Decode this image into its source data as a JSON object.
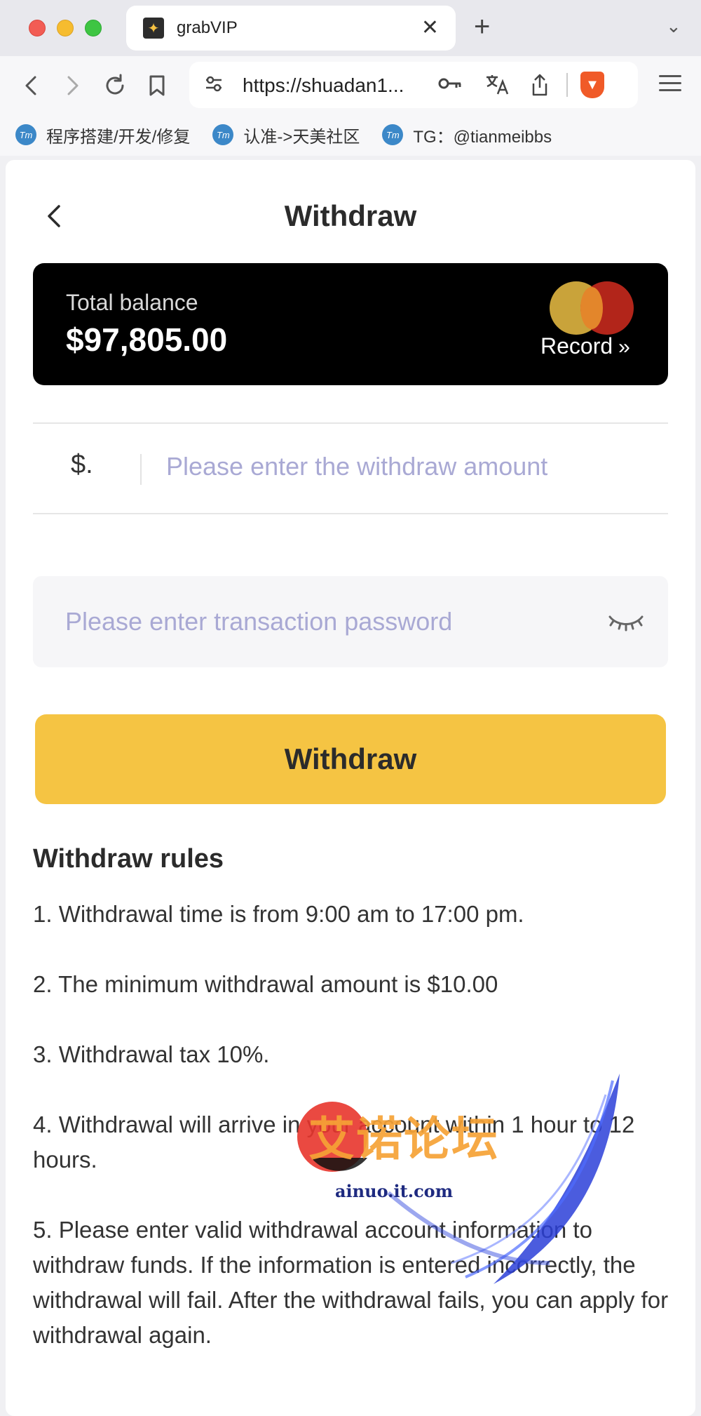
{
  "browser": {
    "tab_title": "grabVIP",
    "tab_close": "✕",
    "new_tab": "+",
    "tab_menu": "⌄",
    "url": "https://shuadan1...",
    "bookmarks": [
      {
        "icon": "Tm",
        "label": "程序搭建/开发/修复"
      },
      {
        "icon": "Tm",
        "label": "认准->天美社区"
      },
      {
        "icon": "Tm",
        "label": "TG：@tianmeibbs"
      }
    ]
  },
  "header": {
    "title": "Withdraw"
  },
  "balance_card": {
    "label": "Total balance",
    "value": "$97,805.00",
    "record_label": "Record",
    "record_arrow": "»"
  },
  "amount": {
    "prefix": "$.",
    "placeholder": "Please enter the withdraw amount"
  },
  "password": {
    "placeholder": "Please enter transaction password"
  },
  "withdraw_button": "Withdraw",
  "rules": {
    "title": "Withdraw rules",
    "items": [
      "1. Withdrawal time is from 9:00 am to 17:00 pm.",
      "2. The minimum withdrawal amount is $10.00",
      "3. Withdrawal tax 10%.",
      "4. Withdrawal will arrive in your account within 1 hour to 12 hours.",
      "5. Please enter valid withdrawal account information to withdraw funds. If the information is entered incorrectly, the withdrawal will fail. After the withdrawal fails, you can apply for withdrawal again."
    ]
  },
  "watermark": {
    "text": "艾诺论坛",
    "url": "ainuo.it.com"
  },
  "colors": {
    "accent": "#f5c443",
    "card_bg": "#000000",
    "placeholder": "#a9a9d4"
  }
}
